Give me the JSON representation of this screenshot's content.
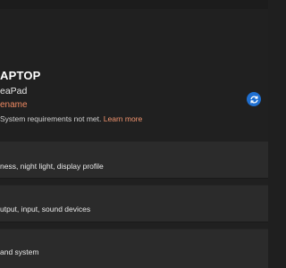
{
  "device": {
    "name": "APTOP",
    "model": "eaPad",
    "rename_label": "ename",
    "requirements_text": "System requirements not met.",
    "learn_more_label": "Learn more"
  },
  "cards": {
    "display_desc": "ness, night light, display profile",
    "sound_desc": "utput, input, sound devices",
    "notifications_desc": "and system"
  },
  "icons": {
    "update": "refresh-icon"
  },
  "colors": {
    "accent_link": "#ef8a62",
    "update_icon": "#1f6fd0",
    "card_bg": "#2b2b2b",
    "window_bg": "#202020"
  }
}
